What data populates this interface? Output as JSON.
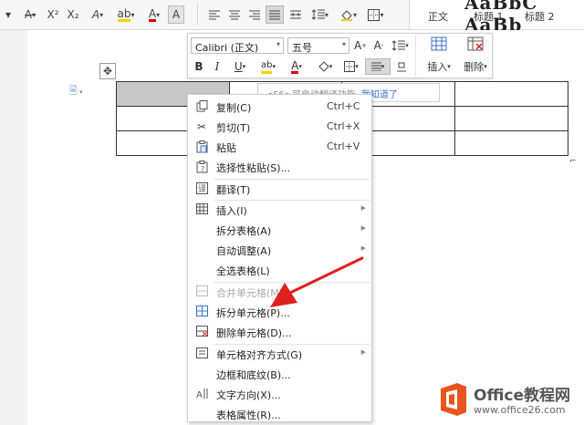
{
  "ribbon": {
    "items": [
      "A",
      "X²",
      "X₂",
      "A",
      "ab",
      "A",
      "A"
    ],
    "styles": {
      "preview": "AaBbC AaBb",
      "items": [
        "正文",
        "标题 1",
        "标题 2"
      ]
    }
  },
  "mini_toolbar": {
    "font_name": "Calibri (正文)",
    "font_size": "五号",
    "insert_label": "插入",
    "delete_label": "删除",
    "bold": "B",
    "italic": "I",
    "underline": "U"
  },
  "tooltip": {
    "text": "<F6>可启动翻译功能",
    "link": "我知道了"
  },
  "context_menu": [
    {
      "label": "复制(C)",
      "shortcut": "Ctrl+C",
      "icon": "copy-icon"
    },
    {
      "label": "剪切(T)",
      "shortcut": "Ctrl+X",
      "icon": "cut-icon"
    },
    {
      "label": "粘贴",
      "shortcut": "Ctrl+V",
      "icon": "paste-icon"
    },
    {
      "label": "选择性粘贴(S)...",
      "icon": "paste-special-icon"
    },
    {
      "label": "翻译(T)",
      "icon": "translate-icon"
    },
    {
      "label": "插入(I)",
      "icon": "insert-table-icon",
      "submenu": true
    },
    {
      "label": "拆分表格(A)",
      "submenu": true
    },
    {
      "label": "自动调整(A)",
      "submenu": true
    },
    {
      "label": "全选表格(L)"
    },
    {
      "label": "合并单元格(M)",
      "icon": "merge-cells-icon",
      "disabled": true
    },
    {
      "label": "拆分单元格(P)...",
      "icon": "split-cells-icon"
    },
    {
      "label": "删除单元格(D)...",
      "icon": "delete-cells-icon"
    },
    {
      "label": "单元格对齐方式(G)",
      "icon": "cell-align-icon",
      "submenu": true
    },
    {
      "label": "边框和底纹(B)..."
    },
    {
      "label": "文字方向(X)...",
      "icon": "text-direction-icon"
    },
    {
      "label": "表格属性(R)..."
    }
  ],
  "watermark": {
    "brand": "Office教程网",
    "url": "www.office26.com"
  },
  "colors": {
    "arrow": "#e02020",
    "logo_orange": "#e8541e",
    "accent": "#3b73c8"
  }
}
